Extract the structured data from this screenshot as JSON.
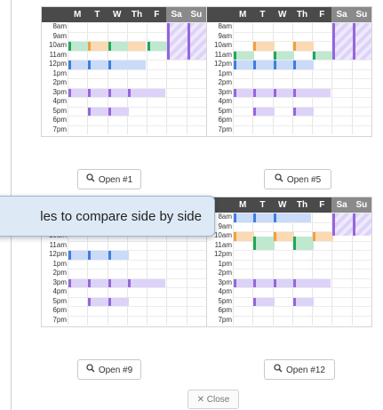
{
  "days": [
    "M",
    "T",
    "W",
    "Th",
    "F",
    "Sa",
    "Su"
  ],
  "hours": [
    "8am",
    "9am",
    "10am",
    "11am",
    "12pm",
    "1pm",
    "2pm",
    "3pm",
    "4pm",
    "5pm",
    "6pm",
    "7pm"
  ],
  "colors": {
    "orange": "#fbd9b3",
    "green": "#bfe8cf",
    "blue": "#c9dbf8",
    "purple": "#ddd2f8",
    "orange_bar": "#f0a040",
    "green_bar": "#1fa85a",
    "blue_bar": "#3d7ee0",
    "purple_bar": "#9466dd"
  },
  "schedules": [
    {
      "button": "Open #1"
    },
    {
      "button": "Open #5"
    },
    {
      "button": "Open #9"
    },
    {
      "button": "Open #12"
    }
  ],
  "tooltip": "les to compare side by side",
  "close_label": "Close"
}
